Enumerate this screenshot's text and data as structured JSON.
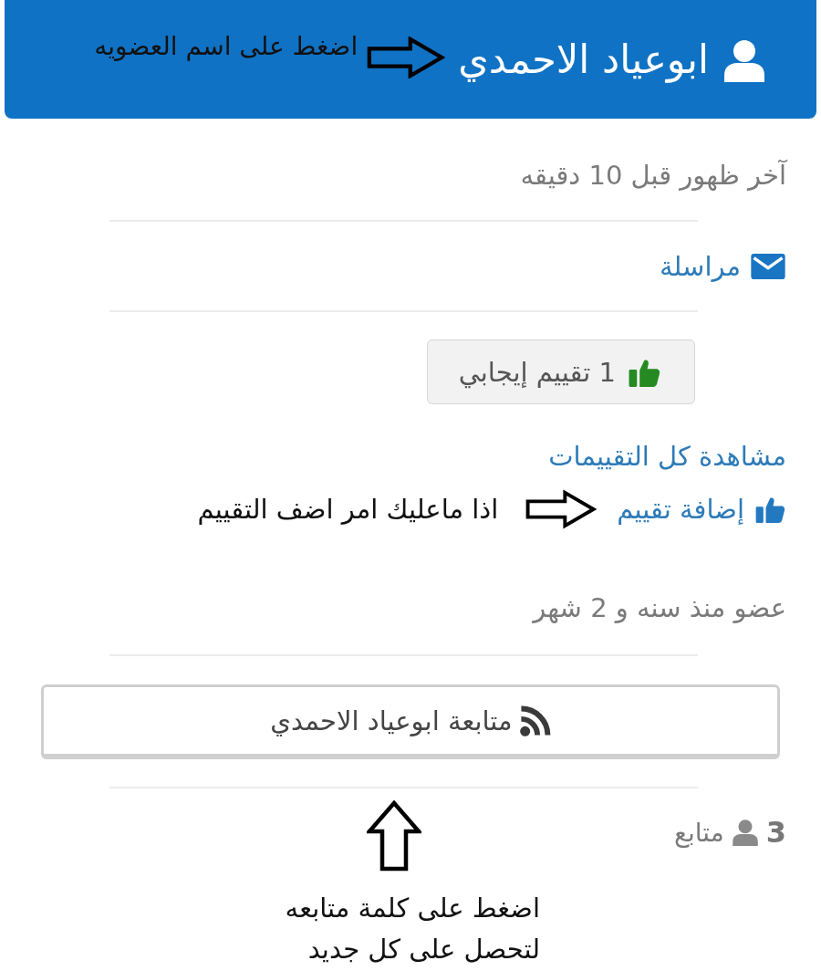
{
  "header": {
    "member_name": "ابوعياد الاحمدي",
    "note": "اضغط على اسم العضويه"
  },
  "last_seen": "آخر ظهور قبل 10 دقيقه",
  "message_link": {
    "label": "مراسلة"
  },
  "rating_button": {
    "label": "1 تقييم إيجابي"
  },
  "view_ratings_link": {
    "label": "مشاهدة كل التقييمات"
  },
  "add_rating": {
    "label": "إضافة تقييم",
    "note": "اذا ماعليك امر اضف التقييم"
  },
  "member_since": "عضو منذ سنه و 2 شهر",
  "follow_button": {
    "label": "متابعة ابوعياد الاحمدي"
  },
  "followers": {
    "count": "3",
    "label": "متابع"
  },
  "follow_note": "اضغط على كلمة متابعه لتحصل على كل جديد"
}
